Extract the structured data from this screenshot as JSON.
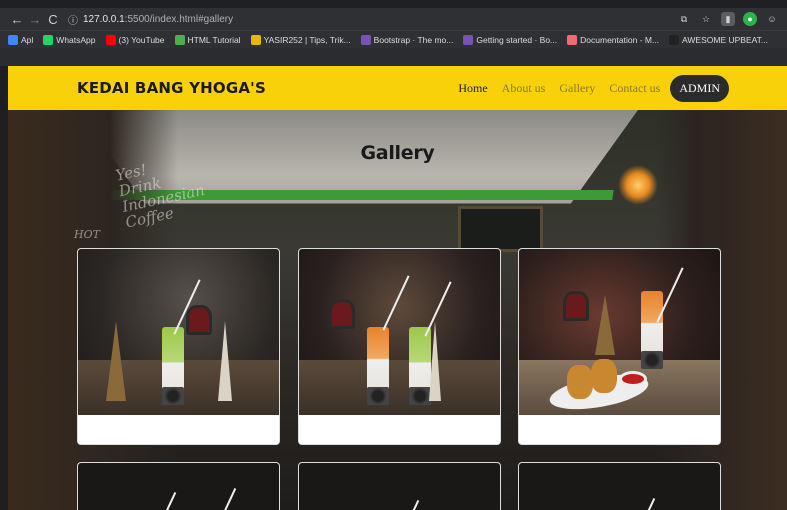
{
  "browser": {
    "url_host": "127.0.0.1",
    "url_rest": ":5500/index.html#gallery",
    "bookmarks": [
      {
        "label": "Apl",
        "icon": "apps-icon",
        "color": "#4285f4"
      },
      {
        "label": "WhatsApp",
        "icon": "whatsapp-icon",
        "color": "#25d366"
      },
      {
        "label": "(3) YouTube",
        "icon": "youtube-icon",
        "color": "#ff0000"
      },
      {
        "label": "HTML Tutorial",
        "icon": "w3schools-icon",
        "color": "#4caf50"
      },
      {
        "label": "YASIR252 | Tips, Trik...",
        "icon": "yasir-icon",
        "color": "#e6b800"
      },
      {
        "label": "Bootstrap · The mo...",
        "icon": "bootstrap-icon",
        "color": "#7952b3"
      },
      {
        "label": "Getting started · Bo...",
        "icon": "bootstrap-icon",
        "color": "#7952b3"
      },
      {
        "label": "Documentation - M...",
        "icon": "materialize-icon",
        "color": "#ee6e73"
      },
      {
        "label": "AWESOME UPBEAT...",
        "icon": "music-flag-icon",
        "color": "#222222"
      }
    ]
  },
  "navbar": {
    "brand": "KEDAI BANG YHOGA'S",
    "links": [
      "Home",
      "About us",
      "Gallery",
      "Contact us"
    ],
    "active_index": 0,
    "admin_label": "ADMIN",
    "bg_color": "#f8d10a"
  },
  "hero": {
    "title": "Gallery",
    "doodle_1": "Yes! Drink Indonesian Coffee",
    "doodle_2": "HOT"
  },
  "cards": [
    {
      "photo": "p1"
    },
    {
      "photo": "p2"
    },
    {
      "photo": "p3"
    },
    {
      "photo": "partial"
    },
    {
      "photo": "partial"
    },
    {
      "photo": "partial"
    }
  ]
}
